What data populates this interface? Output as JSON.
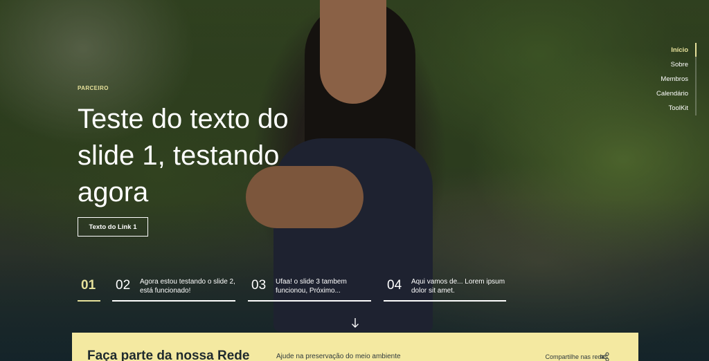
{
  "hero": {
    "eyebrow": "PARCEIRO",
    "headline": "Teste do texto do slide 1, testando agora",
    "cta_label": "Texto do Link 1"
  },
  "nav": {
    "items": [
      {
        "label": "Início",
        "active": true
      },
      {
        "label": "Sobre"
      },
      {
        "label": "Membros"
      },
      {
        "label": "Calendário"
      },
      {
        "label": "ToolKit"
      }
    ]
  },
  "slides": [
    {
      "num": "01",
      "text": "",
      "active": true
    },
    {
      "num": "02",
      "text": "Agora estou testando o slide 2, está funcionado!"
    },
    {
      "num": "03",
      "text": "Ufaa! o slide 3 tambem funcionou, Próximo..."
    },
    {
      "num": "04",
      "text": "Aqui vamos de... Lorem ipsum dolor sit amet."
    }
  ],
  "scroll_icon": "arrow-down-icon",
  "banner": {
    "title": "Faça parte da nossa Rede",
    "subtitle": "Ajude na preservação do meio ambiente",
    "share_label": "Compartilhe nas redes",
    "share_icon": "share-icon"
  },
  "colors": {
    "accent": "#e7e19b",
    "banner_bg": "#f4e9a1",
    "text_light": "#ffffff",
    "text_dark": "#1f2a2e"
  }
}
